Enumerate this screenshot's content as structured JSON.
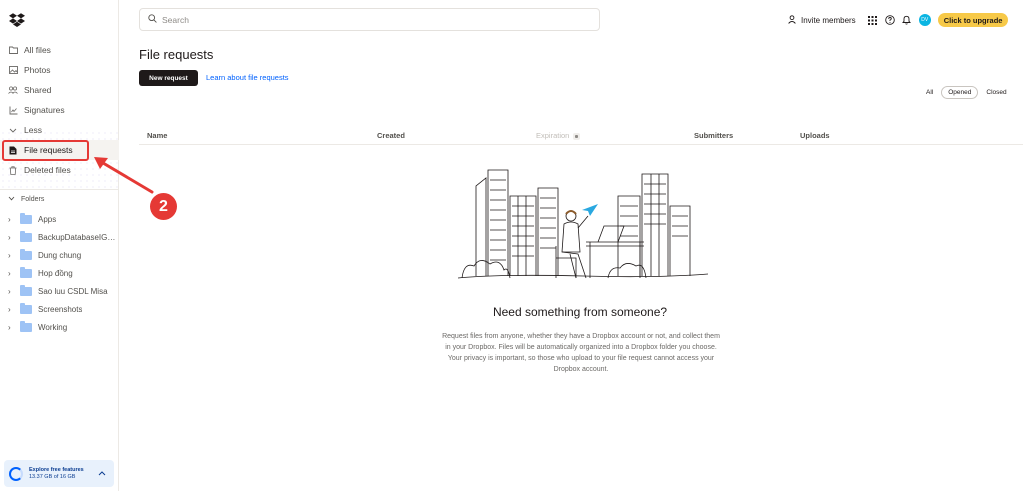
{
  "sidebar": {
    "items": [
      {
        "label": "All files",
        "icon": "folder-outline-icon"
      },
      {
        "label": "Photos",
        "icon": "photo-icon"
      },
      {
        "label": "Shared",
        "icon": "shared-users-icon"
      },
      {
        "label": "Signatures",
        "icon": "signature-icon"
      },
      {
        "label": "Less",
        "icon": "chevron-up-icon"
      },
      {
        "label": "File requests",
        "icon": "file-request-icon"
      },
      {
        "label": "Deleted files",
        "icon": "trash-icon"
      }
    ],
    "folders_label": "Folders",
    "folders": [
      "Apps",
      "BackupDatabaseIGA...",
      "Dung chung",
      "Hop đồng",
      "Sao luu CSDL Misa",
      "Screenshots",
      "Working"
    ],
    "storage": {
      "title": "Explore free features",
      "usage": "13.37 GB of 16 GB",
      "fraction_used": 0.836
    }
  },
  "annotation": {
    "step": "2",
    "color": "#e53935"
  },
  "topbar": {
    "search_placeholder": "Search",
    "invite_label": "Invite members",
    "avatar_initials": "DV",
    "upgrade_label": "Click to upgrade"
  },
  "main": {
    "title": "File requests",
    "new_request_label": "New request",
    "learn_link": "Learn about file requests",
    "filters": [
      "All",
      "Opened",
      "Closed"
    ],
    "selected_filter": "Opened",
    "columns": [
      "Name",
      "Created",
      "Expiration",
      "Submitters",
      "Uploads"
    ],
    "empty_heading": "Need something from someone?",
    "empty_text": "Request files from anyone, whether they have a Dropbox account or not, and collect them in your Dropbox. Files will be automatically organized into a Dropbox folder you choose. Your privacy is important, so those who upload to your file request cannot access your Dropbox account."
  },
  "colors": {
    "accent": "#0061fe",
    "upgrade": "#f7c948",
    "annotation": "#e53935",
    "text": "#1e1919"
  }
}
